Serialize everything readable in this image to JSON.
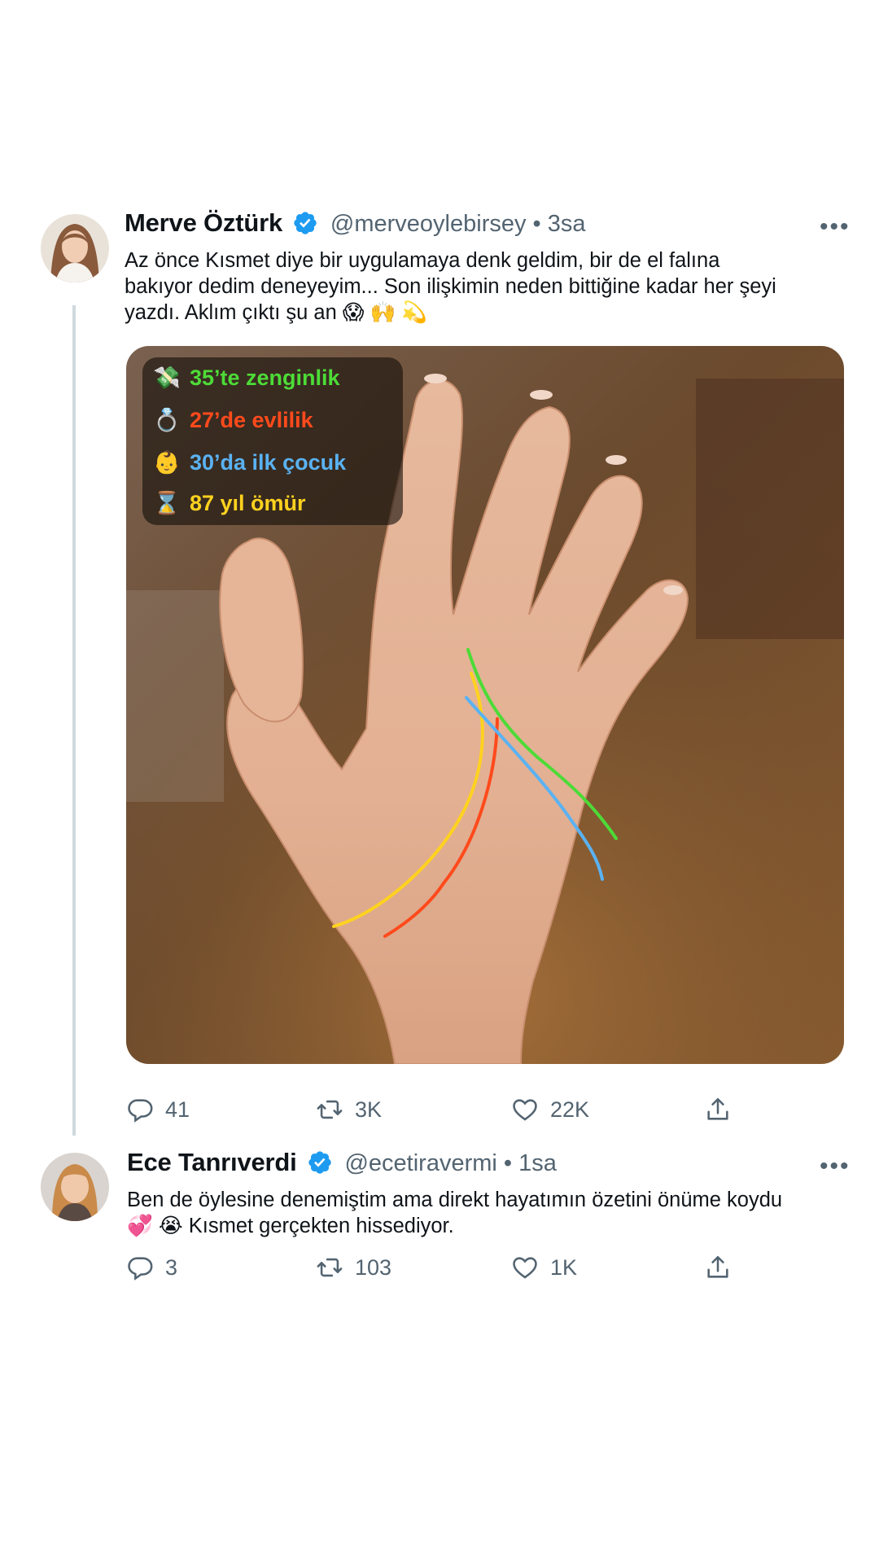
{
  "tweet1": {
    "display_name": "Merve Öztürk",
    "handle_time": "@merveoylebirsey • 3sa",
    "text_line1": "Az önce Kısmet diye bir uygulamaya denk geldim, bir de el falına",
    "text_line2": "bakıyor dedim deneyeyim... Son ilişkimin neden bittiğine kadar her şeyi",
    "text_line3": "yazdı. Aklım çıktı şu an",
    "text_emojis": "😱 🙌 💫",
    "overlay": [
      {
        "icon": "money-wings-icon",
        "emoji": "💸",
        "label": "35’te zenginlik",
        "color": "#4ddb37"
      },
      {
        "icon": "ring-icon",
        "emoji": "💍",
        "label": "27’de evlilik",
        "color": "#ff4a1c"
      },
      {
        "icon": "baby-icon",
        "emoji": "👶",
        "label": "30’da ilk çocuk",
        "color": "#5ab2f2"
      },
      {
        "icon": "hourglass-icon",
        "emoji": "⌛",
        "label": "87 yıl ömür",
        "color": "#ffd21f"
      }
    ],
    "stats": {
      "replies": "41",
      "retweets": "3K",
      "likes": "22K"
    }
  },
  "tweet2": {
    "display_name": "Ece Tanrıverdi",
    "handle_time": "@ecetiravermi • 1sa",
    "text_line1": "Ben de öylesine denemiştim ama direkt hayatımın özetini önüme koydu",
    "text_emojis": "💞 😭",
    "text_line2_rest": "Kısmet gerçekten hissediyor.",
    "stats": {
      "replies": "3",
      "retweets": "103",
      "likes": "1K"
    }
  },
  "icons": {
    "verified": "verified-badge-icon",
    "more": "more-options-icon",
    "reply": "reply-icon",
    "retweet": "retweet-icon",
    "like": "heart-icon",
    "share": "share-icon"
  },
  "colors": {
    "verified": "#1d9bf0",
    "muted": "#536471",
    "thread_line": "#cfd9de"
  }
}
